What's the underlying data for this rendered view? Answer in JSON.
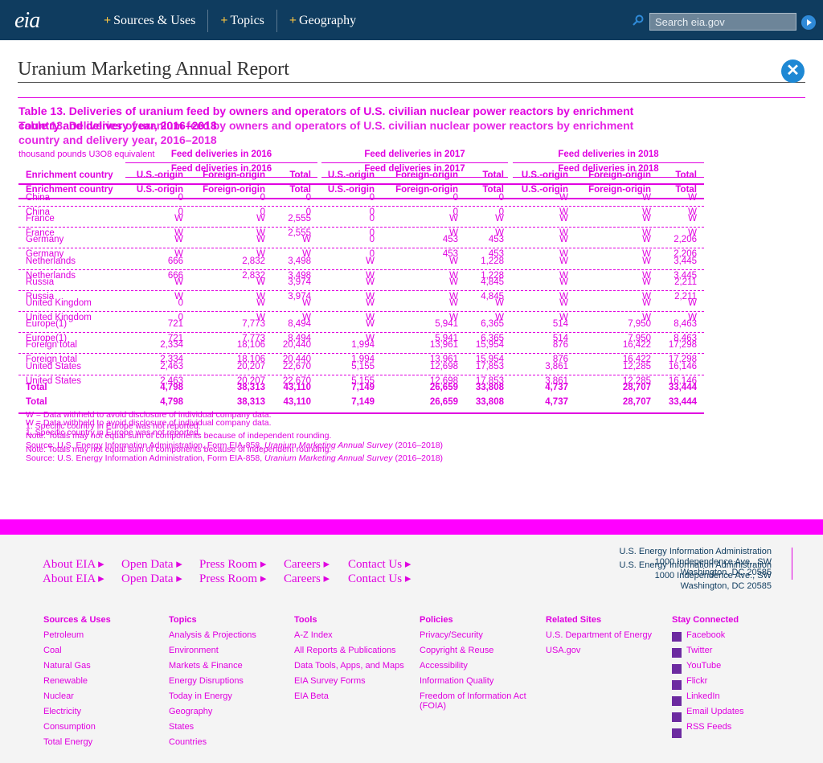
{
  "header": {
    "logo": "eia",
    "nav": [
      "Sources & Uses",
      "Topics",
      "Geography"
    ],
    "search_placeholder": "Search eia.gov"
  },
  "page_title": "Uranium Marketing Annual Report",
  "table": {
    "title_line1": "Table 13. Deliveries of uranium feed by owners and operators of U.S. civilian nuclear power reactors by enrichment",
    "title_line2": "country and delivery year, 2016–2018",
    "unit": "thousand pounds U3O8 equivalent",
    "groups": [
      "Feed deliveries in 2016",
      "Feed deliveries in 2017",
      "Feed deliveries in 2018"
    ],
    "row_header": "Enrichment country",
    "col_headers": [
      "U.S.-origin",
      "Foreign-origin",
      "Total",
      "U.S.-origin",
      "Foreign-origin",
      "Total",
      "U.S.-origin",
      "Foreign-origin",
      "Total"
    ],
    "rows": [
      {
        "label": "China",
        "v": [
          "0",
          "0",
          "0",
          "0",
          "0",
          "0",
          "W",
          "W",
          "W"
        ]
      },
      {
        "label": "France",
        "v": [
          "W",
          "W",
          "2,555",
          "0",
          "W",
          "W",
          "W",
          "W",
          "W"
        ]
      },
      {
        "label": "Germany",
        "v": [
          "W",
          "W",
          "W",
          "0",
          "453",
          "453",
          "W",
          "W",
          "2,206"
        ]
      },
      {
        "label": "Netherlands",
        "v": [
          "666",
          "2,832",
          "3,498",
          "W",
          "W",
          "1,228",
          "W",
          "W",
          "3,445"
        ]
      },
      {
        "label": "Russia",
        "v": [
          "W",
          "W",
          "3,974",
          "W",
          "W",
          "4,845",
          "W",
          "W",
          "2,211"
        ]
      },
      {
        "label": "United Kingdom",
        "v": [
          "0",
          "W",
          "W",
          "W",
          "W",
          "W",
          "W",
          "W",
          "W"
        ]
      },
      {
        "label": "Europe(1)",
        "v": [
          "721",
          "7,773",
          "8,494",
          "W",
          "5,941",
          "6,365",
          "514",
          "7,950",
          "8,463"
        ]
      },
      {
        "label": "Foreign total",
        "v": [
          "2,334",
          "18,106",
          "20,440",
          "1,994",
          "13,961",
          "15,954",
          "876",
          "16,422",
          "17,298"
        ]
      },
      {
        "label": "United States",
        "v": [
          "2,463",
          "20,207",
          "22,670",
          "5,155",
          "12,698",
          "17,853",
          "3,861",
          "12,285",
          "16,146"
        ]
      },
      {
        "label": "Total",
        "v": [
          "4,798",
          "38,313",
          "43,110",
          "7,149",
          "26,659",
          "33,808",
          "4,737",
          "28,707",
          "33,444"
        ]
      }
    ],
    "notes": [
      "W = Data withheld to avoid disclosure of individual company data.",
      "1. Specific country in Europe was not reported.",
      "Note: Totals may not equal sum of components because of independent rounding."
    ],
    "source_prefix": "Source: U.S. Energy Information Administration, Form EIA-858, ",
    "source_italic": "Uranium Marketing Annual Survey",
    "source_suffix": " (2016–2018)"
  },
  "footer": {
    "links": [
      "About EIA",
      "Open Data",
      "Press Room",
      "Careers",
      "Contact Us"
    ],
    "address": [
      "U.S. Energy Information Administration",
      "1000 Independence Ave., SW",
      "Washington, DC 20585"
    ],
    "columns": [
      {
        "heading": "Sources & Uses",
        "items": [
          "Petroleum",
          "Coal",
          "Natural Gas",
          "Renewable",
          "Nuclear",
          "Electricity",
          "Consumption",
          "Total Energy"
        ]
      },
      {
        "heading": "Topics",
        "items": [
          "Analysis & Projections",
          "Environment",
          "Markets & Finance",
          "Energy Disruptions",
          "Today in Energy",
          "Geography",
          "States",
          "Countries"
        ]
      },
      {
        "heading": "Tools",
        "items": [
          "A-Z Index",
          "All Reports & Publications",
          "Data Tools, Apps, and Maps",
          "EIA Survey Forms",
          "EIA Beta"
        ]
      },
      {
        "heading": "Policies",
        "items": [
          "Privacy/Security",
          "Copyright & Reuse",
          "Accessibility",
          "Information Quality",
          "Freedom of Information Act (FOIA)"
        ]
      },
      {
        "heading": "Related Sites",
        "items": [
          "U.S. Department of Energy",
          "USA.gov"
        ]
      },
      {
        "heading": "Stay Connected",
        "items": [
          "Facebook",
          "Twitter",
          "YouTube",
          "Flickr",
          "LinkedIn",
          "Email Updates",
          "RSS Feeds"
        ]
      }
    ]
  }
}
